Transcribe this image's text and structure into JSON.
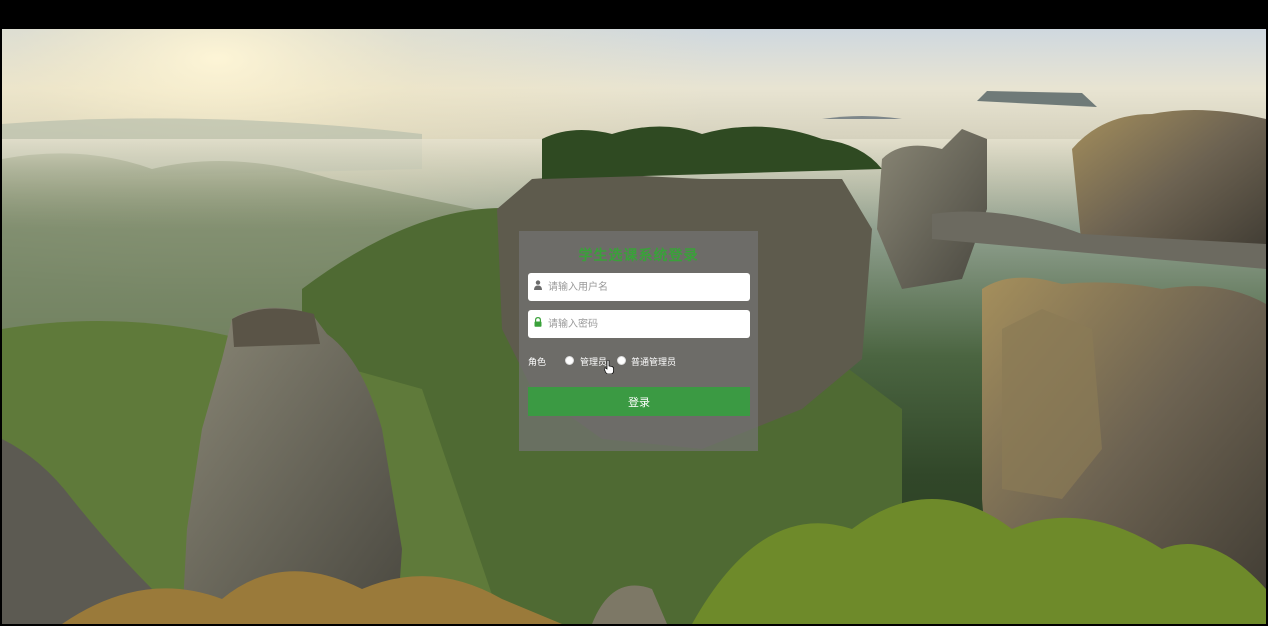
{
  "login": {
    "title": "学生选课系统登录",
    "username_placeholder": "请输入用户名",
    "password_placeholder": "请输入密码",
    "role_label": "角色",
    "role_options": [
      "管理员",
      "普通管理员"
    ],
    "submit_label": "登录"
  },
  "colors": {
    "title": "#3aa13a",
    "button": "#3b9a43",
    "panel": "rgba(115,115,115,0.72)"
  },
  "icons": {
    "user": "user-icon",
    "lock": "lock-icon",
    "pointer": "hand-pointer-icon"
  }
}
